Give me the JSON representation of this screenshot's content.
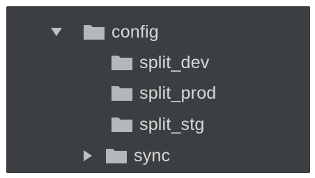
{
  "colors": {
    "panel_bg": "#3c3f41",
    "text": "#d8d8d8",
    "folder": "#b4b8bc",
    "arrow": "#c0c0c0"
  },
  "tree": {
    "root": {
      "label": "config",
      "expanded": true,
      "icon": "folder-icon",
      "arrow_icon": "chevron-down-icon"
    },
    "children": [
      {
        "label": "split_dev",
        "icon": "folder-icon"
      },
      {
        "label": "split_prod",
        "icon": "folder-icon"
      },
      {
        "label": "split_stg",
        "icon": "folder-icon"
      },
      {
        "label": "sync",
        "icon": "folder-icon",
        "expanded": false,
        "arrow_icon": "chevron-right-icon"
      }
    ]
  }
}
